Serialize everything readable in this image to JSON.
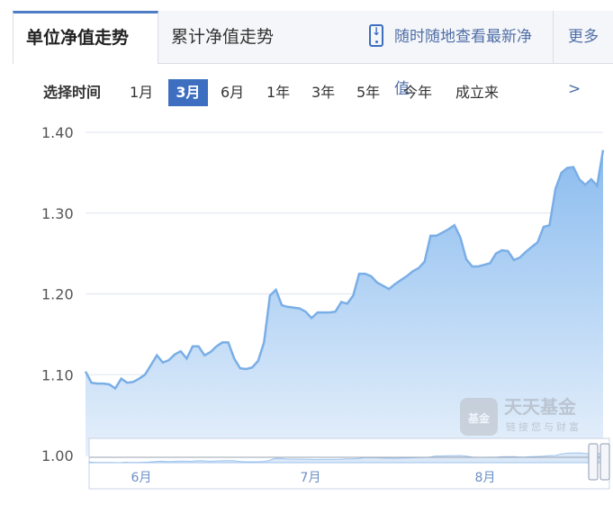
{
  "tabs": {
    "unit_nav": "单位净值走势",
    "cum_nav": "累计净值走势",
    "mobile": "随时随地查看最新净值",
    "more": "更多>"
  },
  "range": {
    "label": "选择时间",
    "options": [
      "1月",
      "3月",
      "6月",
      "1年",
      "3年",
      "5年",
      "今年",
      "成立来"
    ],
    "selected": "3月"
  },
  "watermark": {
    "brand": "天天基金",
    "slogan": "链接您与财富",
    "logo_text": "基金"
  },
  "colors": {
    "line": "#7aaee6",
    "fill_top": "#8bbcef",
    "fill_bottom": "#e6f0fb",
    "accent": "#3d6ec0",
    "grid": "#dde3ee"
  },
  "chart_data": {
    "type": "area",
    "ylim": [
      1.0,
      1.4
    ],
    "yticks": [
      "1.00",
      "1.10",
      "1.20",
      "1.30",
      "1.40"
    ],
    "ytick_values": [
      1.0,
      1.1,
      1.2,
      1.3,
      1.4
    ],
    "navigator_labels": [
      "6月",
      "7月",
      "8月"
    ],
    "series": [
      {
        "values": [
          1.104,
          1.09,
          1.089,
          1.089,
          1.088,
          1.083,
          1.095,
          1.09,
          1.091,
          1.095,
          1.1,
          1.112,
          1.124,
          1.115,
          1.118,
          1.125,
          1.129,
          1.12,
          1.135,
          1.135,
          1.124,
          1.128,
          1.135,
          1.14,
          1.14,
          1.12,
          1.108,
          1.107,
          1.109,
          1.117,
          1.14,
          1.198,
          1.205,
          1.186,
          1.184,
          1.183,
          1.182,
          1.178,
          1.17,
          1.177,
          1.177,
          1.177,
          1.178,
          1.19,
          1.188,
          1.198,
          1.225,
          1.225,
          1.222,
          1.214,
          1.21,
          1.206,
          1.212,
          1.217,
          1.222,
          1.228,
          1.232,
          1.24,
          1.272,
          1.272,
          1.276,
          1.28,
          1.285,
          1.27,
          1.243,
          1.234,
          1.234,
          1.236,
          1.238,
          1.25,
          1.254,
          1.253,
          1.242,
          1.245,
          1.252,
          1.258,
          1.264,
          1.283,
          1.285,
          1.33,
          1.35,
          1.356,
          1.357,
          1.342,
          1.335,
          1.342,
          1.334,
          1.378
        ]
      }
    ]
  }
}
